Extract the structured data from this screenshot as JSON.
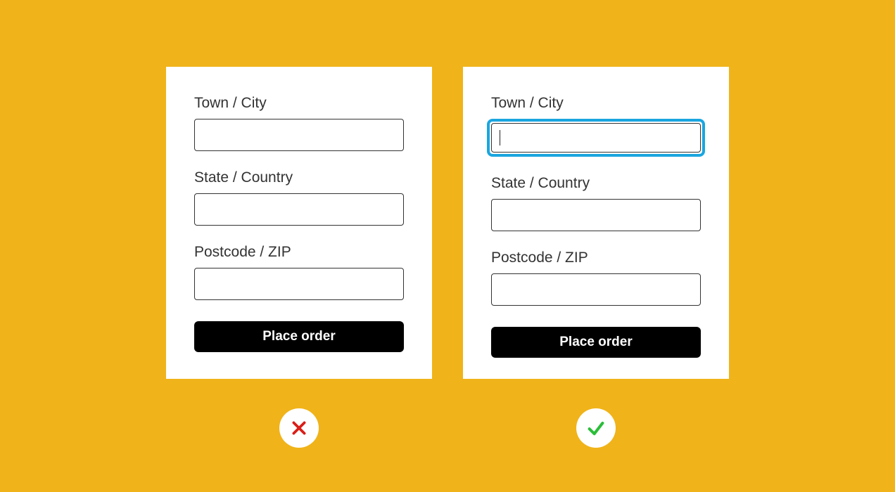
{
  "left": {
    "fields": {
      "town": {
        "label": "Town / City",
        "value": ""
      },
      "state": {
        "label": "State / Country",
        "value": ""
      },
      "postcode": {
        "label": "Postcode / ZIP",
        "value": ""
      }
    },
    "submit_label": "Place order",
    "status": "cross"
  },
  "right": {
    "fields": {
      "town": {
        "label": "Town / City",
        "value": "",
        "focused": true
      },
      "state": {
        "label": "State / Country",
        "value": ""
      },
      "postcode": {
        "label": "Postcode / ZIP",
        "value": ""
      }
    },
    "submit_label": "Place order",
    "status": "check"
  }
}
